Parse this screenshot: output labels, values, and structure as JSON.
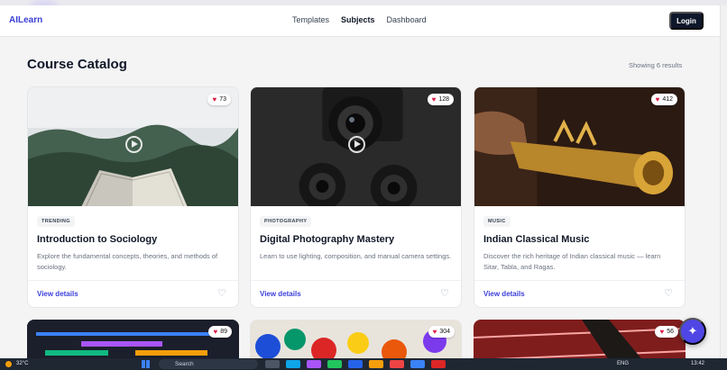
{
  "nav": {
    "brand": "AILearn",
    "links": [
      "Templates",
      "Subjects",
      "Dashboard"
    ],
    "login_label": "Login"
  },
  "catalog": {
    "heading": "Course Catalog",
    "results_text": "Showing 6 results",
    "details_label": "View details",
    "courses": [
      {
        "tag": "TRENDING",
        "title": "Introduction to Sociology",
        "description": "Explore the fundamental concepts, theories, and methods of sociology.",
        "likes": "73",
        "thumbnail": "misty-forest-open-book",
        "has_video": true
      },
      {
        "tag": "PHOTOGRAPHY",
        "title": "Digital Photography Mastery",
        "description": "Learn to use lighting, composition, and manual camera settings.",
        "likes": "128",
        "thumbnail": "camera-lenses",
        "has_video": true
      },
      {
        "tag": "MUSIC",
        "title": "Indian Classical Music",
        "description": "Discover the rich heritage of Indian classical music — learn Sitar, Tabla, and Ragas.",
        "likes": "412",
        "thumbnail": "trumpet-player",
        "has_video": false
      }
    ],
    "next_row": [
      {
        "likes": "89",
        "thumbnail": "video-editing-timeline"
      },
      {
        "likes": "304",
        "thumbnail": "paint-tubes"
      },
      {
        "likes": "56",
        "thumbnail": "running-track"
      }
    ]
  },
  "taskbar": {
    "temperature": "32°C",
    "search_placeholder": "Search",
    "language": "ENG",
    "time": "13:42"
  },
  "colors": {
    "accent": "#3b3fd8",
    "login_bg": "#0f172a",
    "fab": "#4f46e5",
    "heart": "#e11d48"
  }
}
